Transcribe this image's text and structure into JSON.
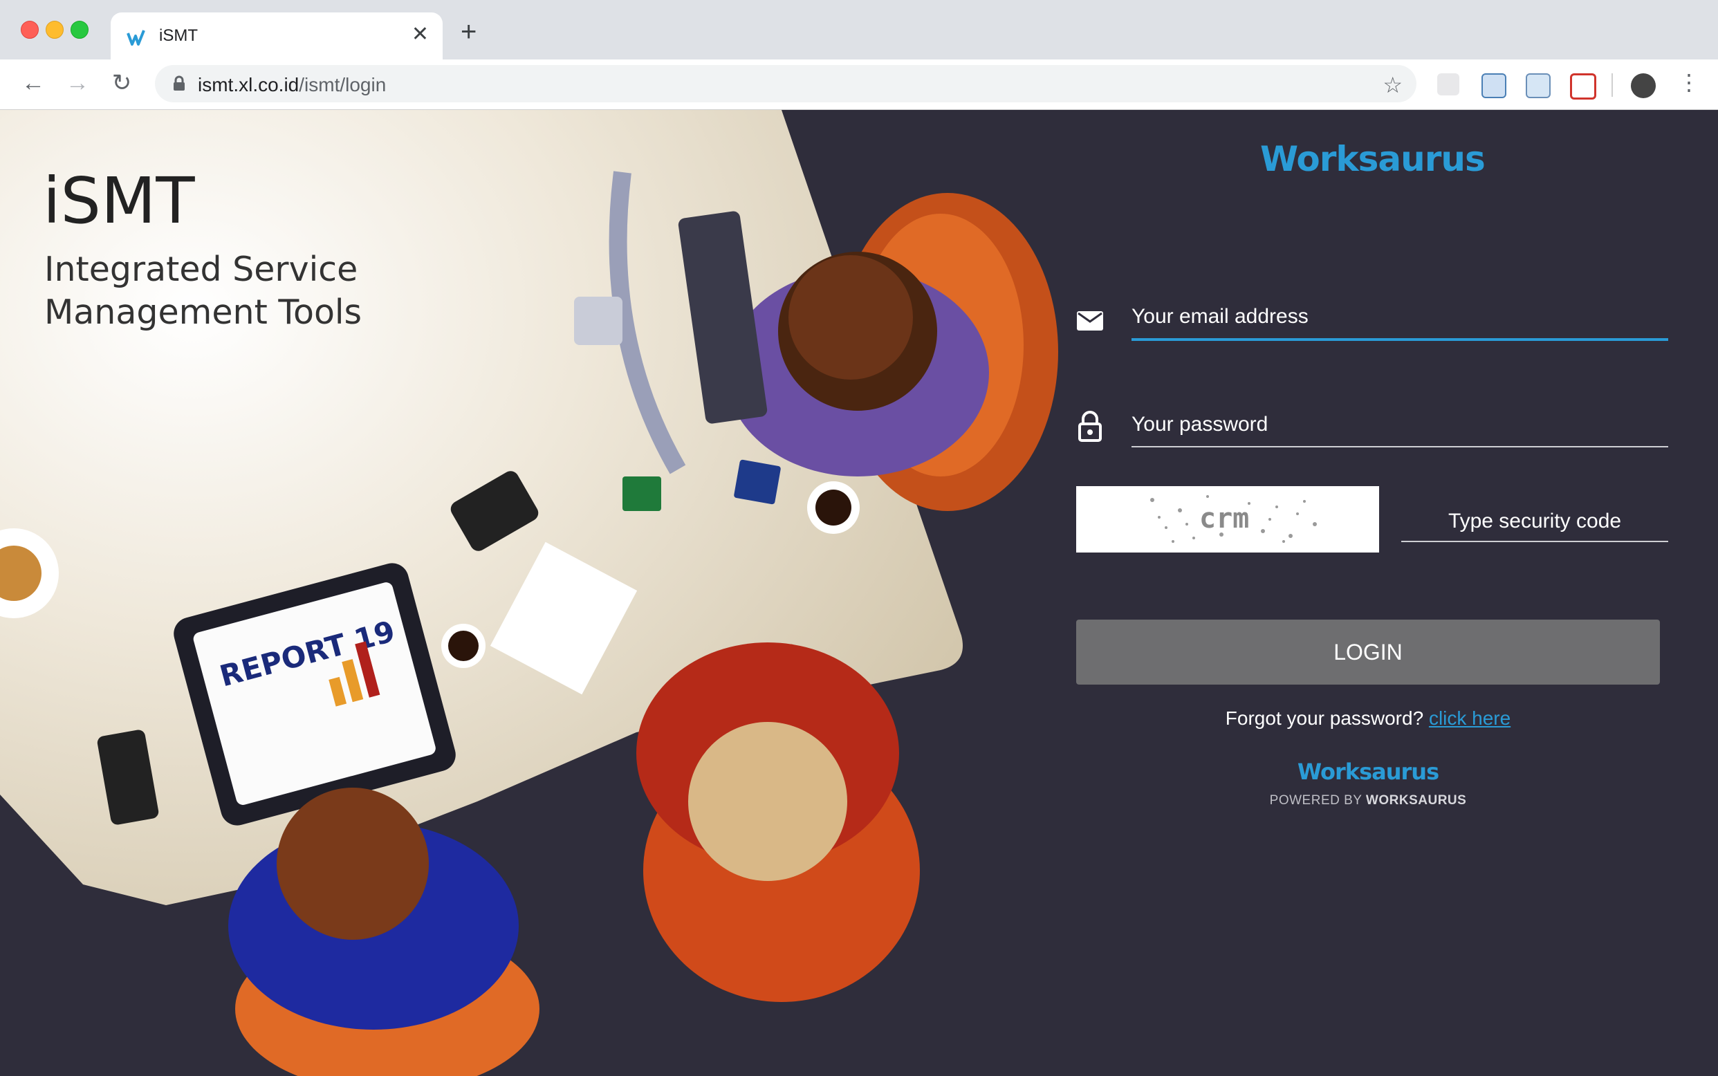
{
  "browser": {
    "tab_title": "iSMT",
    "url_host": "ismt.xl.co.id",
    "url_path": "/ismt/login"
  },
  "brand": {
    "title": "iSMT",
    "subtitle_line1": "Integrated Service",
    "subtitle_line2": "Management Tools"
  },
  "illustration": {
    "report_text": "REPORT 19"
  },
  "login": {
    "logo_text": "Worksaurus",
    "email_placeholder": "Your email address",
    "password_placeholder": "Your password",
    "captcha_text": "crm",
    "captcha_placeholder": "Type security code",
    "login_button": "LOGIN",
    "forgot_text": "Forgot your password?",
    "forgot_link": "click here",
    "powered_logo": "Worksaurus",
    "powered_by_prefix": "POWERED BY",
    "powered_by_brand": "WORKSAURUS"
  },
  "colors": {
    "accent": "#2a9bd6",
    "background": "#2f2d3b",
    "button": "#6e6e70"
  }
}
